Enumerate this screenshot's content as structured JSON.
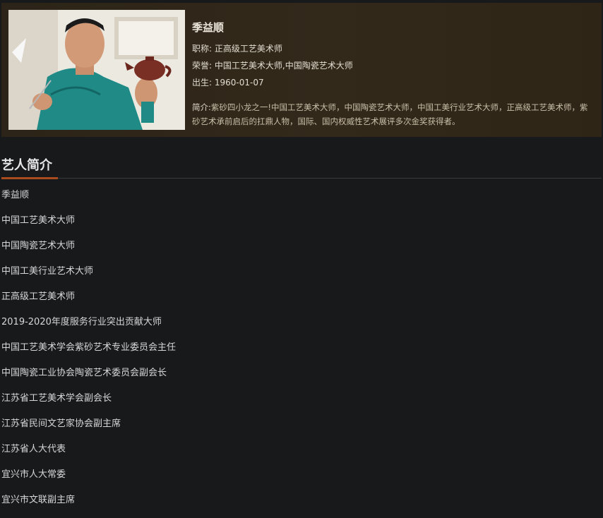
{
  "artist": {
    "name": "季益顺",
    "title_label": "职称:",
    "title_value": "正高级工艺美术师",
    "honor_label": "荣誉:",
    "honor_value": "中国工艺美术大师,中国陶瓷艺术大师",
    "birth_label": "出生:",
    "birth_value": "1960-01-07",
    "intro_label": "简介:",
    "intro_value": "紫砂四小龙之一!中国工艺美术大师，中国陶瓷艺术大师，中国工美行业艺术大师，正高级工艺美术师，紫砂艺术承前启后的扛鼎人物，国际、国内权威性艺术展评多次金奖获得者。"
  },
  "section": {
    "title": "艺人简介"
  },
  "bio_items": [
    "季益顺",
    "中国工艺美术大师",
    "中国陶瓷艺术大师",
    "中国工美行业艺术大师",
    "正高级工艺美术师",
    "2019-2020年度服务行业突出贡献大师",
    "中国工艺美术学会紫砂艺术专业委员会主任",
    "中国陶瓷工业协会陶瓷艺术委员会副会长",
    "江苏省工艺美术学会副会长",
    "江苏省民间文艺家协会副主席",
    "江苏省人大代表",
    "宜兴市人大常委",
    "宜兴市文联副主席"
  ],
  "colors": {
    "page_bg": "#18191b",
    "card_bg": "#2f2619",
    "accent": "#a94b1d"
  }
}
